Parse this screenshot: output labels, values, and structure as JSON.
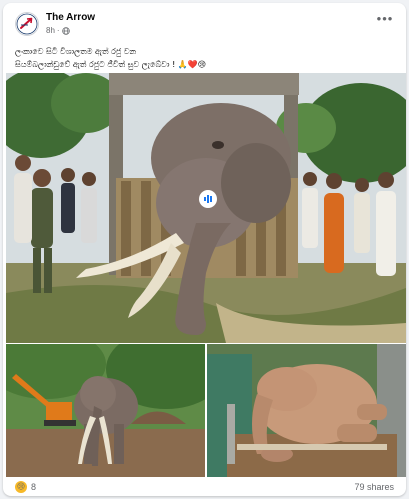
{
  "post": {
    "page_name": "The Arrow",
    "time": "8h",
    "privacy_icon": "globe-icon",
    "caption_line1": "ලංකාවෙ සිටි විශාලතම ඇත් රජු වන",
    "caption_line2": "සියම්බලාන්ඩුවේ ඇත් රජුට ජීවිත් සුව ලැබේවා !",
    "caption_emojis": "🙏❤️😢",
    "more_icon": "ellipsis-icon"
  },
  "media": {
    "main_image": "elephant-in-crate-photo",
    "left_image": "elephant-standing-photo",
    "right_image": "elephant-lying-truck-photo",
    "badge_icon": "watermark-badge-icon"
  },
  "footer": {
    "reaction_icon": "sad-reaction-icon",
    "reaction_count": "8",
    "shares_text": "79 shares"
  },
  "colors": {
    "card_background": "#ffffff",
    "page_background": "#f0f2f5",
    "secondary_text": "#65676b"
  }
}
